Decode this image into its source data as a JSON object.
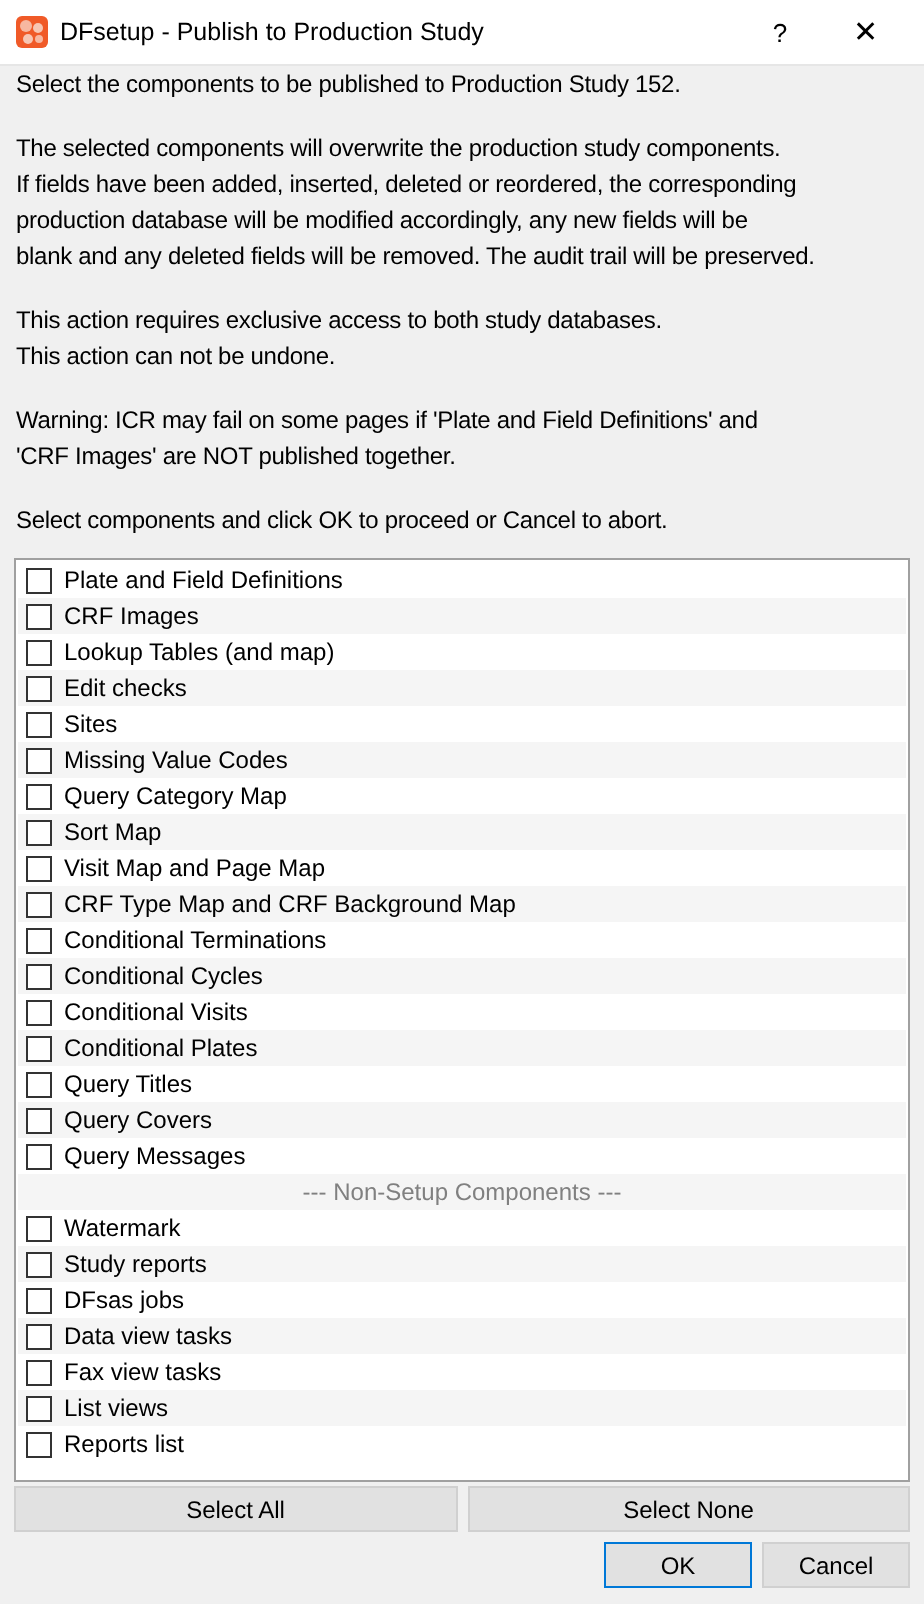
{
  "window": {
    "title": "DFsetup - Publish to Production Study",
    "help": "?",
    "close": "✕"
  },
  "message": [
    "Select the components to be published to Production Study 152.",
    "The selected components will overwrite the production study components.\nIf fields have been added, inserted, deleted or reordered, the corresponding\nproduction database will be modified accordingly, any new fields will be\nblank and any deleted fields will be removed. The audit trail will be preserved.",
    "This action requires exclusive access to both study databases.\nThis action can not be undone.",
    "Warning: ICR may fail on some pages if 'Plate and Field Definitions' and\n'CRF Images' are NOT published together.",
    "Select components and click OK to proceed or Cancel to abort."
  ],
  "components": [
    {
      "kind": "checkbox",
      "label": "Plate and Field Definitions",
      "checked": false
    },
    {
      "kind": "checkbox",
      "label": "CRF Images",
      "checked": false
    },
    {
      "kind": "checkbox",
      "label": "Lookup Tables (and map)",
      "checked": false
    },
    {
      "kind": "checkbox",
      "label": "Edit checks",
      "checked": false
    },
    {
      "kind": "checkbox",
      "label": "Sites",
      "checked": false
    },
    {
      "kind": "checkbox",
      "label": "Missing Value Codes",
      "checked": false
    },
    {
      "kind": "checkbox",
      "label": "Query Category Map",
      "checked": false
    },
    {
      "kind": "checkbox",
      "label": "Sort Map",
      "checked": false
    },
    {
      "kind": "checkbox",
      "label": "Visit Map and Page Map",
      "checked": false
    },
    {
      "kind": "checkbox",
      "label": "CRF Type Map and CRF Background Map",
      "checked": false
    },
    {
      "kind": "checkbox",
      "label": "Conditional Terminations",
      "checked": false
    },
    {
      "kind": "checkbox",
      "label": "Conditional Cycles",
      "checked": false
    },
    {
      "kind": "checkbox",
      "label": "Conditional Visits",
      "checked": false
    },
    {
      "kind": "checkbox",
      "label": "Conditional Plates",
      "checked": false
    },
    {
      "kind": "checkbox",
      "label": "Query Titles",
      "checked": false
    },
    {
      "kind": "checkbox",
      "label": "Query Covers",
      "checked": false
    },
    {
      "kind": "checkbox",
      "label": "Query Messages",
      "checked": false
    },
    {
      "kind": "separator",
      "label": "--- Non-Setup Components ---"
    },
    {
      "kind": "checkbox",
      "label": "Watermark",
      "checked": false
    },
    {
      "kind": "checkbox",
      "label": "Study reports",
      "checked": false
    },
    {
      "kind": "checkbox",
      "label": "DFsas jobs",
      "checked": false
    },
    {
      "kind": "checkbox",
      "label": "Data view tasks",
      "checked": false
    },
    {
      "kind": "checkbox",
      "label": "Fax view tasks",
      "checked": false
    },
    {
      "kind": "checkbox",
      "label": "List views",
      "checked": false
    },
    {
      "kind": "checkbox",
      "label": "Reports list",
      "checked": false
    }
  ],
  "select_buttons": [
    {
      "label": "Select All",
      "default": false
    },
    {
      "label": "Select None",
      "default": false
    }
  ],
  "dialog_buttons": [
    {
      "label": "OK",
      "default": true
    },
    {
      "label": "Cancel",
      "default": false
    }
  ]
}
